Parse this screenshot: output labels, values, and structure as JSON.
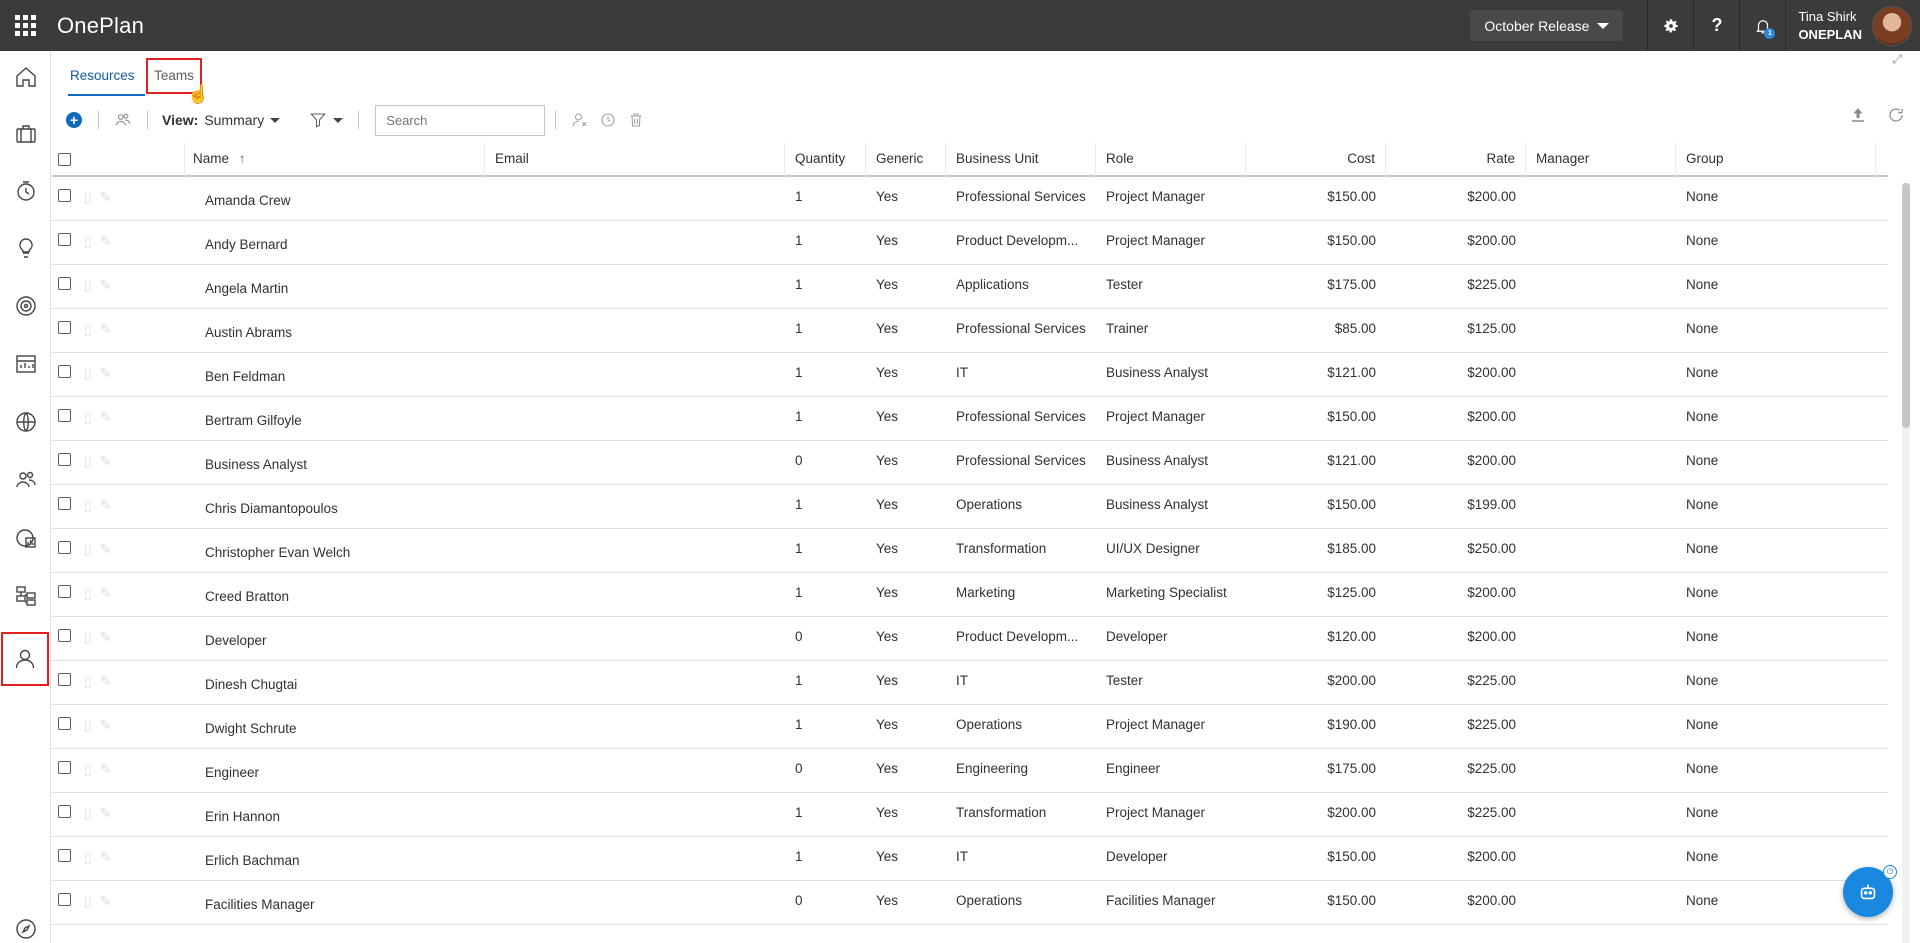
{
  "app": {
    "title": "OnePlan"
  },
  "header": {
    "release": "October Release",
    "settings_icon": "gear-icon",
    "help_label": "?",
    "notification_count": "1",
    "user_name": "Tina Shirk",
    "user_org": "ONEPLAN"
  },
  "tabs": [
    {
      "label": "Resources",
      "active": true
    },
    {
      "label": "Teams",
      "active": false
    }
  ],
  "toolbar": {
    "view_prefix": "View:",
    "view_value": "Summary",
    "search_placeholder": "Search"
  },
  "columns": [
    "Name",
    "Email",
    "Quantity",
    "Generic",
    "Business Unit",
    "Role",
    "Cost",
    "Rate",
    "Manager",
    "Group"
  ],
  "sort_indicator": "↑",
  "rows": [
    {
      "name": "Amanda Crew",
      "email": "",
      "quantity": "1",
      "generic": "Yes",
      "business_unit": "Professional Services",
      "role": "Project Manager",
      "cost": "$150.00",
      "rate": "$200.00",
      "manager": "",
      "group": "None"
    },
    {
      "name": "Andy Bernard",
      "email": "",
      "quantity": "1",
      "generic": "Yes",
      "business_unit": "Product Developm...",
      "role": "Project Manager",
      "cost": "$150.00",
      "rate": "$200.00",
      "manager": "",
      "group": "None"
    },
    {
      "name": "Angela Martin",
      "email": "",
      "quantity": "1",
      "generic": "Yes",
      "business_unit": "Applications",
      "role": "Tester",
      "cost": "$175.00",
      "rate": "$225.00",
      "manager": "",
      "group": "None"
    },
    {
      "name": "Austin Abrams",
      "email": "",
      "quantity": "1",
      "generic": "Yes",
      "business_unit": "Professional Services",
      "role": "Trainer",
      "cost": "$85.00",
      "rate": "$125.00",
      "manager": "",
      "group": "None"
    },
    {
      "name": "Ben Feldman",
      "email": "",
      "quantity": "1",
      "generic": "Yes",
      "business_unit": "IT",
      "role": "Business Analyst",
      "cost": "$121.00",
      "rate": "$200.00",
      "manager": "",
      "group": "None"
    },
    {
      "name": "Bertram Gilfoyle",
      "email": "",
      "quantity": "1",
      "generic": "Yes",
      "business_unit": "Professional Services",
      "role": "Project Manager",
      "cost": "$150.00",
      "rate": "$200.00",
      "manager": "",
      "group": "None"
    },
    {
      "name": "Business Analyst",
      "email": "",
      "quantity": "0",
      "generic": "Yes",
      "business_unit": "Professional Services",
      "role": "Business Analyst",
      "cost": "$121.00",
      "rate": "$200.00",
      "manager": "",
      "group": "None"
    },
    {
      "name": "Chris Diamantopoulos",
      "email": "",
      "quantity": "1",
      "generic": "Yes",
      "business_unit": "Operations",
      "role": "Business Analyst",
      "cost": "$150.00",
      "rate": "$199.00",
      "manager": "",
      "group": "None"
    },
    {
      "name": "Christopher Evan Welch",
      "email": "",
      "quantity": "1",
      "generic": "Yes",
      "business_unit": "Transformation",
      "role": "UI/UX Designer",
      "cost": "$185.00",
      "rate": "$250.00",
      "manager": "",
      "group": "None"
    },
    {
      "name": "Creed Bratton",
      "email": "",
      "quantity": "1",
      "generic": "Yes",
      "business_unit": "Marketing",
      "role": "Marketing Specialist",
      "cost": "$125.00",
      "rate": "$200.00",
      "manager": "",
      "group": "None"
    },
    {
      "name": "Developer",
      "email": "",
      "quantity": "0",
      "generic": "Yes",
      "business_unit": "Product Developm...",
      "role": "Developer",
      "cost": "$120.00",
      "rate": "$200.00",
      "manager": "",
      "group": "None"
    },
    {
      "name": "Dinesh Chugtai",
      "email": "",
      "quantity": "1",
      "generic": "Yes",
      "business_unit": "IT",
      "role": "Tester",
      "cost": "$200.00",
      "rate": "$225.00",
      "manager": "",
      "group": "None"
    },
    {
      "name": "Dwight Schrute",
      "email": "",
      "quantity": "1",
      "generic": "Yes",
      "business_unit": "Operations",
      "role": "Project Manager",
      "cost": "$190.00",
      "rate": "$225.00",
      "manager": "",
      "group": "None"
    },
    {
      "name": "Engineer",
      "email": "",
      "quantity": "0",
      "generic": "Yes",
      "business_unit": "Engineering",
      "role": "Engineer",
      "cost": "$175.00",
      "rate": "$225.00",
      "manager": "",
      "group": "None"
    },
    {
      "name": "Erin Hannon",
      "email": "",
      "quantity": "1",
      "generic": "Yes",
      "business_unit": "Transformation",
      "role": "Project Manager",
      "cost": "$200.00",
      "rate": "$225.00",
      "manager": "",
      "group": "None"
    },
    {
      "name": "Erlich Bachman",
      "email": "",
      "quantity": "1",
      "generic": "Yes",
      "business_unit": "IT",
      "role": "Developer",
      "cost": "$150.00",
      "rate": "$200.00",
      "manager": "",
      "group": "None"
    },
    {
      "name": "Facilities Manager",
      "email": "",
      "quantity": "0",
      "generic": "Yes",
      "business_unit": "Operations",
      "role": "Facilities Manager",
      "cost": "$150.00",
      "rate": "$200.00",
      "manager": "",
      "group": "None"
    }
  ],
  "sidebar": {
    "items": [
      {
        "name": "home-icon"
      },
      {
        "name": "briefcase-icon"
      },
      {
        "name": "timesheet-icon"
      },
      {
        "name": "lightbulb-icon"
      },
      {
        "name": "target-icon"
      },
      {
        "name": "reports-icon"
      },
      {
        "name": "globe-icon"
      },
      {
        "name": "people-icon"
      },
      {
        "name": "portfolio-report-icon"
      },
      {
        "name": "hierarchy-icon"
      },
      {
        "name": "resource-icon",
        "active": true
      },
      {
        "name": "compass-icon"
      }
    ]
  }
}
